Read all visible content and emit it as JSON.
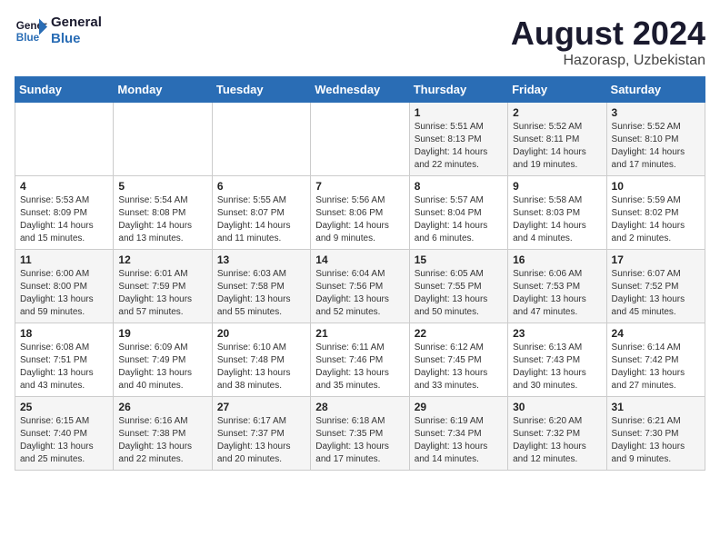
{
  "header": {
    "logo_line1": "General",
    "logo_line2": "Blue",
    "title": "August 2024",
    "subtitle": "Hazorasp, Uzbekistan"
  },
  "weekdays": [
    "Sunday",
    "Monday",
    "Tuesday",
    "Wednesday",
    "Thursday",
    "Friday",
    "Saturday"
  ],
  "weeks": [
    [
      {
        "day": "",
        "content": ""
      },
      {
        "day": "",
        "content": ""
      },
      {
        "day": "",
        "content": ""
      },
      {
        "day": "",
        "content": ""
      },
      {
        "day": "1",
        "content": "Sunrise: 5:51 AM\nSunset: 8:13 PM\nDaylight: 14 hours\nand 22 minutes."
      },
      {
        "day": "2",
        "content": "Sunrise: 5:52 AM\nSunset: 8:11 PM\nDaylight: 14 hours\nand 19 minutes."
      },
      {
        "day": "3",
        "content": "Sunrise: 5:52 AM\nSunset: 8:10 PM\nDaylight: 14 hours\nand 17 minutes."
      }
    ],
    [
      {
        "day": "4",
        "content": "Sunrise: 5:53 AM\nSunset: 8:09 PM\nDaylight: 14 hours\nand 15 minutes."
      },
      {
        "day": "5",
        "content": "Sunrise: 5:54 AM\nSunset: 8:08 PM\nDaylight: 14 hours\nand 13 minutes."
      },
      {
        "day": "6",
        "content": "Sunrise: 5:55 AM\nSunset: 8:07 PM\nDaylight: 14 hours\nand 11 minutes."
      },
      {
        "day": "7",
        "content": "Sunrise: 5:56 AM\nSunset: 8:06 PM\nDaylight: 14 hours\nand 9 minutes."
      },
      {
        "day": "8",
        "content": "Sunrise: 5:57 AM\nSunset: 8:04 PM\nDaylight: 14 hours\nand 6 minutes."
      },
      {
        "day": "9",
        "content": "Sunrise: 5:58 AM\nSunset: 8:03 PM\nDaylight: 14 hours\nand 4 minutes."
      },
      {
        "day": "10",
        "content": "Sunrise: 5:59 AM\nSunset: 8:02 PM\nDaylight: 14 hours\nand 2 minutes."
      }
    ],
    [
      {
        "day": "11",
        "content": "Sunrise: 6:00 AM\nSunset: 8:00 PM\nDaylight: 13 hours\nand 59 minutes."
      },
      {
        "day": "12",
        "content": "Sunrise: 6:01 AM\nSunset: 7:59 PM\nDaylight: 13 hours\nand 57 minutes."
      },
      {
        "day": "13",
        "content": "Sunrise: 6:03 AM\nSunset: 7:58 PM\nDaylight: 13 hours\nand 55 minutes."
      },
      {
        "day": "14",
        "content": "Sunrise: 6:04 AM\nSunset: 7:56 PM\nDaylight: 13 hours\nand 52 minutes."
      },
      {
        "day": "15",
        "content": "Sunrise: 6:05 AM\nSunset: 7:55 PM\nDaylight: 13 hours\nand 50 minutes."
      },
      {
        "day": "16",
        "content": "Sunrise: 6:06 AM\nSunset: 7:53 PM\nDaylight: 13 hours\nand 47 minutes."
      },
      {
        "day": "17",
        "content": "Sunrise: 6:07 AM\nSunset: 7:52 PM\nDaylight: 13 hours\nand 45 minutes."
      }
    ],
    [
      {
        "day": "18",
        "content": "Sunrise: 6:08 AM\nSunset: 7:51 PM\nDaylight: 13 hours\nand 43 minutes."
      },
      {
        "day": "19",
        "content": "Sunrise: 6:09 AM\nSunset: 7:49 PM\nDaylight: 13 hours\nand 40 minutes."
      },
      {
        "day": "20",
        "content": "Sunrise: 6:10 AM\nSunset: 7:48 PM\nDaylight: 13 hours\nand 38 minutes."
      },
      {
        "day": "21",
        "content": "Sunrise: 6:11 AM\nSunset: 7:46 PM\nDaylight: 13 hours\nand 35 minutes."
      },
      {
        "day": "22",
        "content": "Sunrise: 6:12 AM\nSunset: 7:45 PM\nDaylight: 13 hours\nand 33 minutes."
      },
      {
        "day": "23",
        "content": "Sunrise: 6:13 AM\nSunset: 7:43 PM\nDaylight: 13 hours\nand 30 minutes."
      },
      {
        "day": "24",
        "content": "Sunrise: 6:14 AM\nSunset: 7:42 PM\nDaylight: 13 hours\nand 27 minutes."
      }
    ],
    [
      {
        "day": "25",
        "content": "Sunrise: 6:15 AM\nSunset: 7:40 PM\nDaylight: 13 hours\nand 25 minutes."
      },
      {
        "day": "26",
        "content": "Sunrise: 6:16 AM\nSunset: 7:38 PM\nDaylight: 13 hours\nand 22 minutes."
      },
      {
        "day": "27",
        "content": "Sunrise: 6:17 AM\nSunset: 7:37 PM\nDaylight: 13 hours\nand 20 minutes."
      },
      {
        "day": "28",
        "content": "Sunrise: 6:18 AM\nSunset: 7:35 PM\nDaylight: 13 hours\nand 17 minutes."
      },
      {
        "day": "29",
        "content": "Sunrise: 6:19 AM\nSunset: 7:34 PM\nDaylight: 13 hours\nand 14 minutes."
      },
      {
        "day": "30",
        "content": "Sunrise: 6:20 AM\nSunset: 7:32 PM\nDaylight: 13 hours\nand 12 minutes."
      },
      {
        "day": "31",
        "content": "Sunrise: 6:21 AM\nSunset: 7:30 PM\nDaylight: 13 hours\nand 9 minutes."
      }
    ]
  ]
}
